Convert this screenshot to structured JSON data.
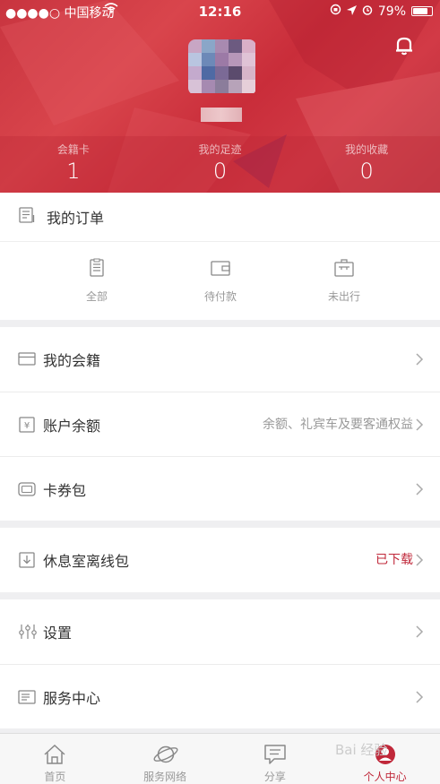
{
  "status_bar": {
    "carrier": "●●●●○ 中国移动",
    "time": "12:16",
    "battery": "79%",
    "battery_level": 0.79
  },
  "profile": {
    "stats": [
      {
        "label": "会籍卡",
        "value": "1"
      },
      {
        "label": "我的足迹",
        "value": "0"
      },
      {
        "label": "我的收藏",
        "value": "0"
      }
    ]
  },
  "orders": {
    "title": "我的订单",
    "ops": [
      {
        "label": "全部",
        "icon": "document-icon"
      },
      {
        "label": "待付款",
        "icon": "wallet-icon"
      },
      {
        "label": "未出行",
        "icon": "luggage-icon"
      }
    ]
  },
  "menu": {
    "membership": {
      "label": "我的会籍"
    },
    "balance": {
      "label": "账户余额",
      "sub": "余额、礼宾车及要客通权益"
    },
    "coupons": {
      "label": "卡券包"
    },
    "lounge": {
      "label": "休息室离线包",
      "sub": "已下载"
    },
    "settings": {
      "label": "设置"
    },
    "service": {
      "label": "服务中心"
    }
  },
  "tabbar": {
    "tabs": [
      {
        "label": "首页",
        "icon": "home-icon"
      },
      {
        "label": "服务网络",
        "icon": "planet-icon"
      },
      {
        "label": "分享",
        "icon": "chat-icon"
      },
      {
        "label": "个人中心",
        "icon": "profile-icon"
      }
    ],
    "active_index": 3
  },
  "watermark": "Bai 经验",
  "colors": {
    "brand_red": "#c0283a",
    "header_red": "#c8343f"
  }
}
